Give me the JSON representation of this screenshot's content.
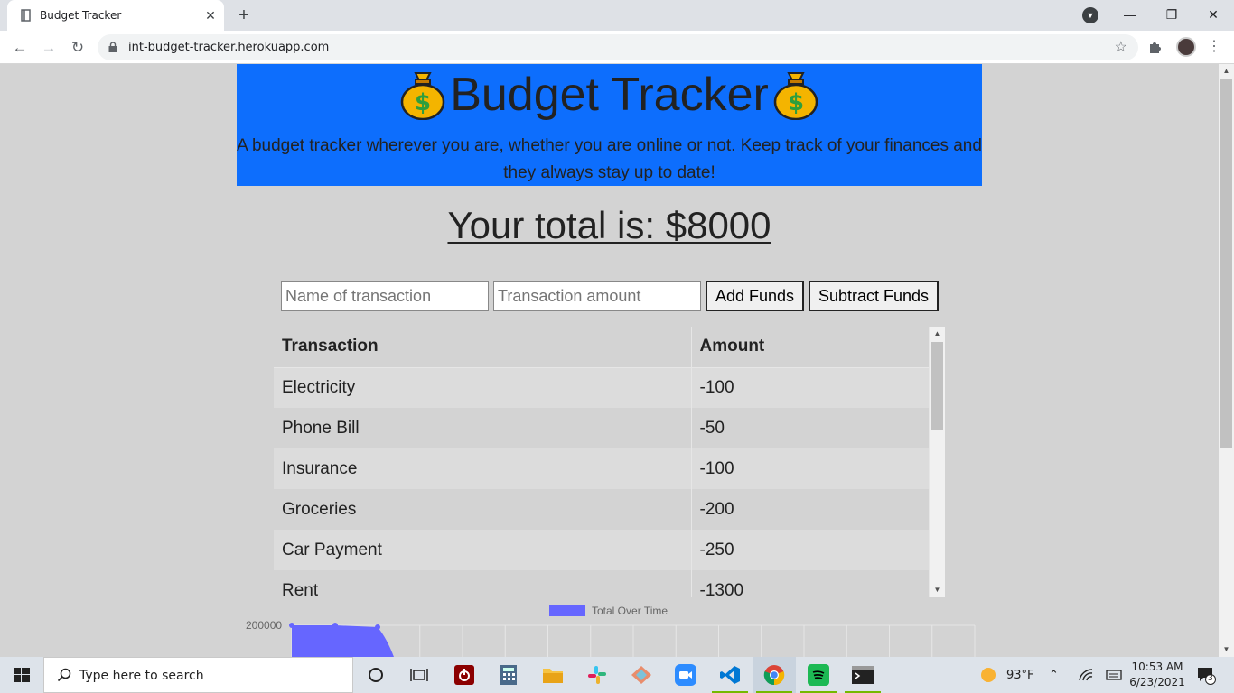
{
  "browser": {
    "tab_title": "Budget Tracker",
    "url": "int-budget-tracker.herokuapp.com"
  },
  "header": {
    "title": "Budget Tracker",
    "tagline": "A budget tracker wherever you are, whether you are online or not. Keep track of your finances and they always stay up to date!"
  },
  "total": {
    "label": "Your total is: $",
    "amount": "8000"
  },
  "form": {
    "name_placeholder": "Name of transaction",
    "amount_placeholder": "Transaction amount",
    "add_label": "Add Funds",
    "subtract_label": "Subtract Funds"
  },
  "table": {
    "headers": [
      "Transaction",
      "Amount"
    ],
    "rows": [
      {
        "name": "Electricity",
        "amount": "-100"
      },
      {
        "name": "Phone Bill",
        "amount": "-50"
      },
      {
        "name": "Insurance",
        "amount": "-100"
      },
      {
        "name": "Groceries",
        "amount": "-200"
      },
      {
        "name": "Car Payment",
        "amount": "-250"
      },
      {
        "name": "Rent",
        "amount": "-1300"
      }
    ]
  },
  "chart_data": {
    "type": "area",
    "legend": "Total Over Time",
    "y_tick_top": "200000",
    "series": [
      {
        "name": "Total Over Time",
        "color": "#6666ff"
      }
    ]
  },
  "taskbar": {
    "search_placeholder": "Type here to search",
    "weather": "93°F",
    "time": "10:53 AM",
    "date": "6/23/2021",
    "notifications": "3"
  },
  "colors": {
    "header_bg": "#0d6efd",
    "page_bg": "#d3d3d3",
    "chart_fill": "#6666ff"
  }
}
